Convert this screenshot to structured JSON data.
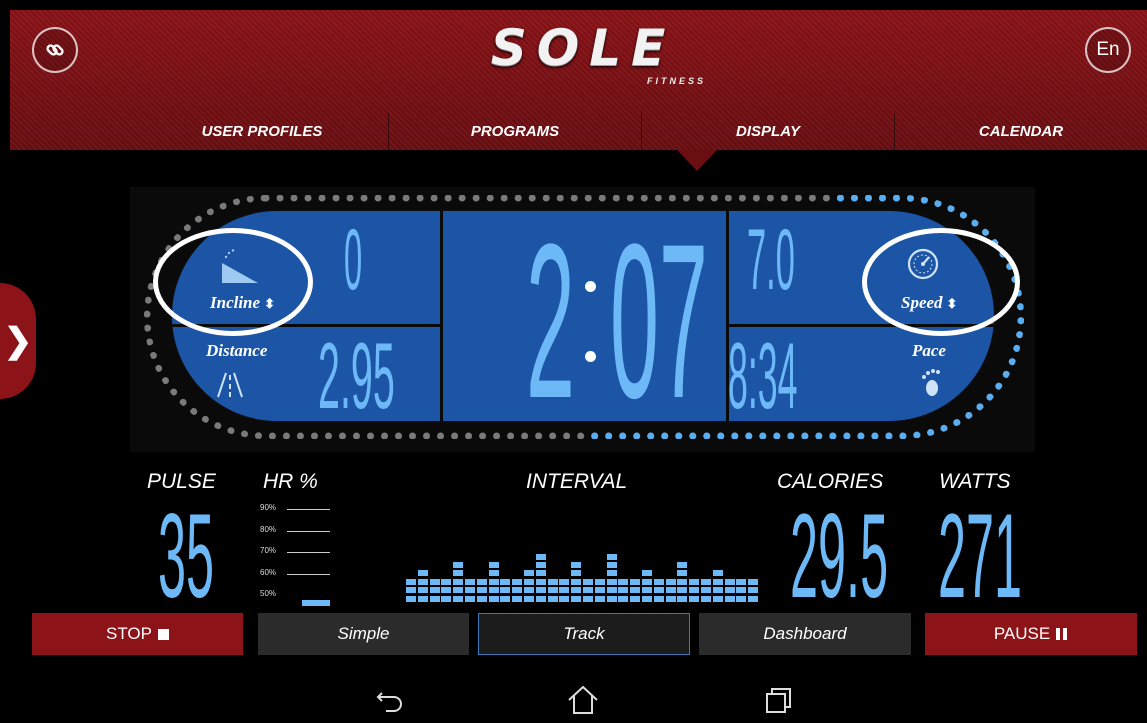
{
  "header": {
    "logo_main": "SOLE",
    "logo_sub": "FITNESS",
    "language_label": "En",
    "nav": [
      "USER PROFILES",
      "PROGRAMS",
      "DISPLAY",
      "CALENDAR"
    ],
    "active_nav": "DISPLAY"
  },
  "display": {
    "incline": {
      "label": "Incline",
      "value": "0"
    },
    "distance": {
      "label": "Distance",
      "value": "2.95"
    },
    "time": {
      "minutes": "2",
      "seconds": "07"
    },
    "speed": {
      "label": "Speed",
      "value": "7.0"
    },
    "pace": {
      "label": "Pace",
      "value": "8:34"
    }
  },
  "stats": {
    "pulse": {
      "label": "PULSE",
      "value": "35"
    },
    "hr": {
      "label": "HR %",
      "ticks": [
        "90%",
        "80%",
        "70%",
        "60%",
        "50%"
      ],
      "level_fraction": 0.1
    },
    "interval": {
      "label": "INTERVAL",
      "column_heights": [
        3,
        4,
        3,
        3,
        5,
        3,
        3,
        5,
        3,
        3,
        4,
        6,
        3,
        3,
        5,
        3,
        3,
        6,
        3,
        3,
        4,
        3,
        3,
        5,
        3,
        3,
        4,
        3,
        3,
        3
      ]
    },
    "calories": {
      "label": "CALORIES",
      "value": "29.5"
    },
    "watts": {
      "label": "WATTS",
      "value": "271"
    }
  },
  "controls": {
    "stop": "STOP",
    "simple": "Simple",
    "track": "Track",
    "dashboard": "Dashboard",
    "pause": "PAUSE",
    "active_view": "Track"
  },
  "colors": {
    "brand_red": "#8c1318",
    "display_blue": "#1d55a6",
    "digit_blue": "#6db9f7"
  },
  "icons": {
    "link": "link-icon",
    "incline": "incline-icon",
    "distance": "road-icon",
    "speed": "speedometer-icon",
    "pace": "footprint-icon",
    "back": "back-icon",
    "home": "home-icon",
    "recents": "recent-apps-icon"
  }
}
